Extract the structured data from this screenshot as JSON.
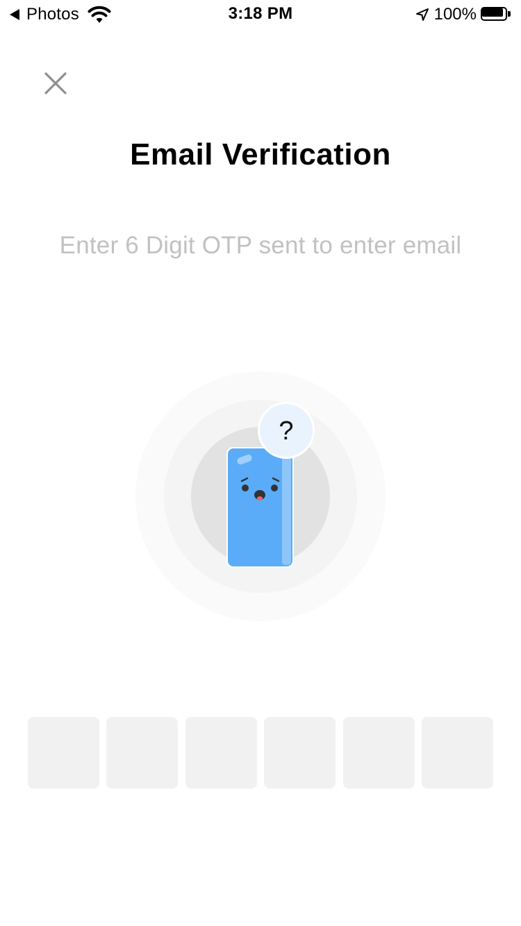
{
  "status_bar": {
    "back_label": "Photos",
    "time": "3:18 PM",
    "battery_percent": "100%",
    "battery_level": 1.0,
    "icons": [
      "back-arrow-icon",
      "wifi-icon",
      "location-arrow-icon",
      "battery-icon"
    ]
  },
  "header": {
    "close_icon": "close-icon",
    "title": "Email Verification",
    "subtitle": "Enter 6 Digit OTP sent to enter email"
  },
  "illustration": {
    "icon": "confused-phone-icon",
    "badge_text": "?",
    "colors": {
      "outer_ring": "#fafafa",
      "middle_ring": "#f4f4f4",
      "inner_ring": "#e2e2e2",
      "phone": "#5aacf8",
      "badge": "#e9f3fd"
    }
  },
  "otp": {
    "digit_count": 6,
    "values": [
      "",
      "",
      "",
      "",
      "",
      ""
    ],
    "box_color": "#f1f1f1"
  },
  "colors": {
    "background": "#ffffff",
    "subtitle_text": "#c1c1c1",
    "close_icon": "#8e8e8e"
  }
}
